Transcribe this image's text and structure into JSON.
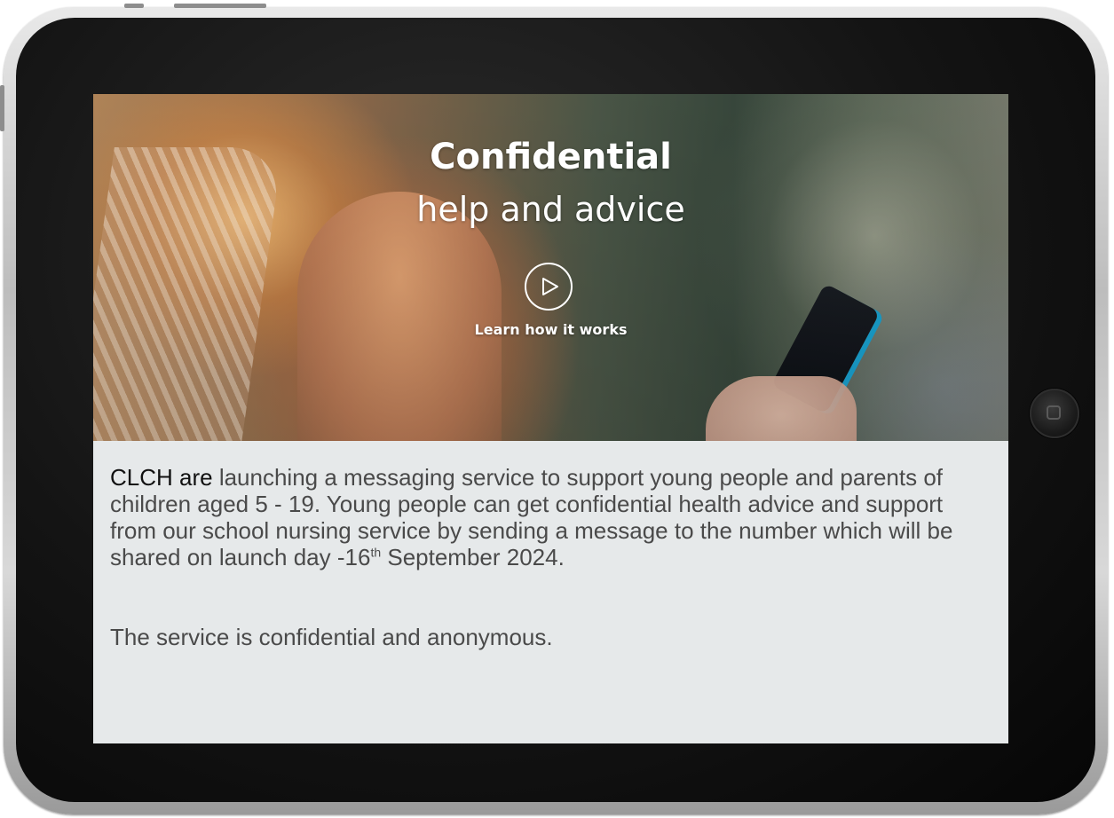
{
  "hero": {
    "title_line1": "Confidential",
    "title_line2": "help and advice",
    "play_icon": "play-icon",
    "learn_label": "Learn how it works"
  },
  "content": {
    "lead_bold": "CLCH are",
    "paragraph_main": " launching a messaging service to support young people and parents of children aged 5 - 19. Young people can get confidential health advice and support from our school nursing service by sending a message to the number which will be shared on launch day -16",
    "superscript": "th",
    "paragraph_end": " September 2024.",
    "footer_line": "The service is confidential and anonymous."
  },
  "colors": {
    "screen_bg": "#e6e9ea",
    "body_text": "#4a4a4a",
    "lead_text": "#111111",
    "hero_text": "#ffffff"
  }
}
